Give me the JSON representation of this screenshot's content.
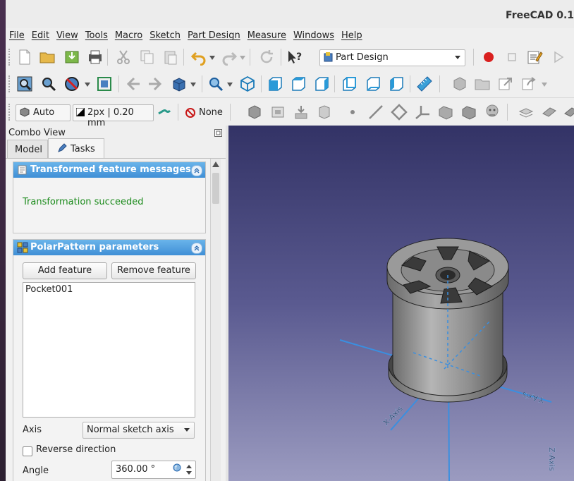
{
  "window": {
    "title": "FreeCAD 0.1"
  },
  "menu": {
    "items": [
      "File",
      "Edit",
      "View",
      "Tools",
      "Macro",
      "Sketch",
      "Part Design",
      "Measure",
      "Windows",
      "Help"
    ]
  },
  "toolbar": {
    "workbench_selector": "Part Design",
    "draw_style_label": "Auto",
    "line_width_label": "2px | 0.20 mm",
    "selection_filter_label": "None"
  },
  "combo_view": {
    "title": "Combo View",
    "tabs": [
      {
        "label": "Model"
      },
      {
        "label": "Tasks"
      }
    ]
  },
  "task_panel": {
    "messages_box": {
      "title": "Transformed feature messages",
      "message": "Transformation succeeded",
      "message_color": "#1a8a1a"
    },
    "polar_box": {
      "title": "PolarPattern parameters",
      "add_feature_label": "Add feature",
      "remove_feature_label": "Remove feature",
      "features": [
        "Pocket001"
      ],
      "axis_label": "Axis",
      "axis_value": "Normal sketch axis",
      "reverse_label": "Reverse direction",
      "reverse_checked": false,
      "angle_label": "Angle",
      "angle_value": "360.00 °"
    }
  },
  "viewport": {
    "axis_labels": {
      "x": "X-Axis",
      "y": "Y-Axis",
      "z": "Z-Axis"
    },
    "axis_color": "#3a8fe0"
  },
  "colors": {
    "header_blue": "#4a9ce0",
    "accent_red": "#d9201f"
  }
}
